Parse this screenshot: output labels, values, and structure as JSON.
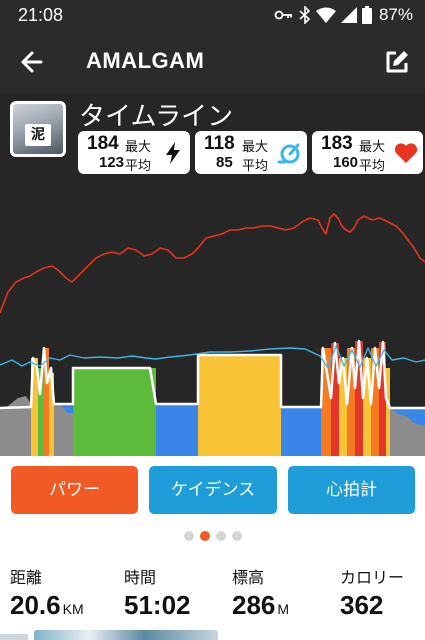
{
  "status_bar": {
    "time": "21:08",
    "battery": "87%"
  },
  "app_bar": {
    "title": "AMALGAM"
  },
  "activity": {
    "title": "タイムライン",
    "avatar_bib": "泥",
    "stats": {
      "power": {
        "max": "184",
        "max_label": "最大",
        "avg": "123",
        "avg_label": "平均",
        "icon": "lightning-bolt-icon"
      },
      "cadence": {
        "max": "118",
        "max_label": "最大",
        "avg": "85",
        "avg_label": "平均",
        "icon": "cadence-gauge-icon"
      },
      "heart": {
        "max": "183",
        "max_label": "最大",
        "avg": "160",
        "avg_label": "平均",
        "icon": "heart-icon"
      }
    }
  },
  "tabs": {
    "power": "パワー",
    "cadence": "ケイデンス",
    "heart": "心拍計"
  },
  "pager": {
    "count": 4,
    "active": 1
  },
  "metrics": {
    "distance": {
      "label": "距離",
      "value": "20.6",
      "unit": "KM"
    },
    "time": {
      "label": "時間",
      "value": "51:02"
    },
    "elevation": {
      "label": "標高",
      "value": "286",
      "unit": "M"
    },
    "calories": {
      "label": "カロリー",
      "value": "362"
    }
  },
  "colors": {
    "bar_bg": "#2b2b2b",
    "panel_bg": "#262626",
    "accent": "#f15a24",
    "tab_power": "#f15a24",
    "tab_cadence": "#1e9dd8",
    "tab_heart": "#1e9dd8",
    "heart_rate_line": "#e8331f",
    "cadence_line": "#3db7e8",
    "zone_green": "#5dbb3b",
    "zone_yellow": "#f9c338",
    "zone_blue": "#3a86e8",
    "zone_orange": "#f57a22",
    "zone_red": "#e2362a",
    "elevation_fill": "#8c8c8c"
  }
}
